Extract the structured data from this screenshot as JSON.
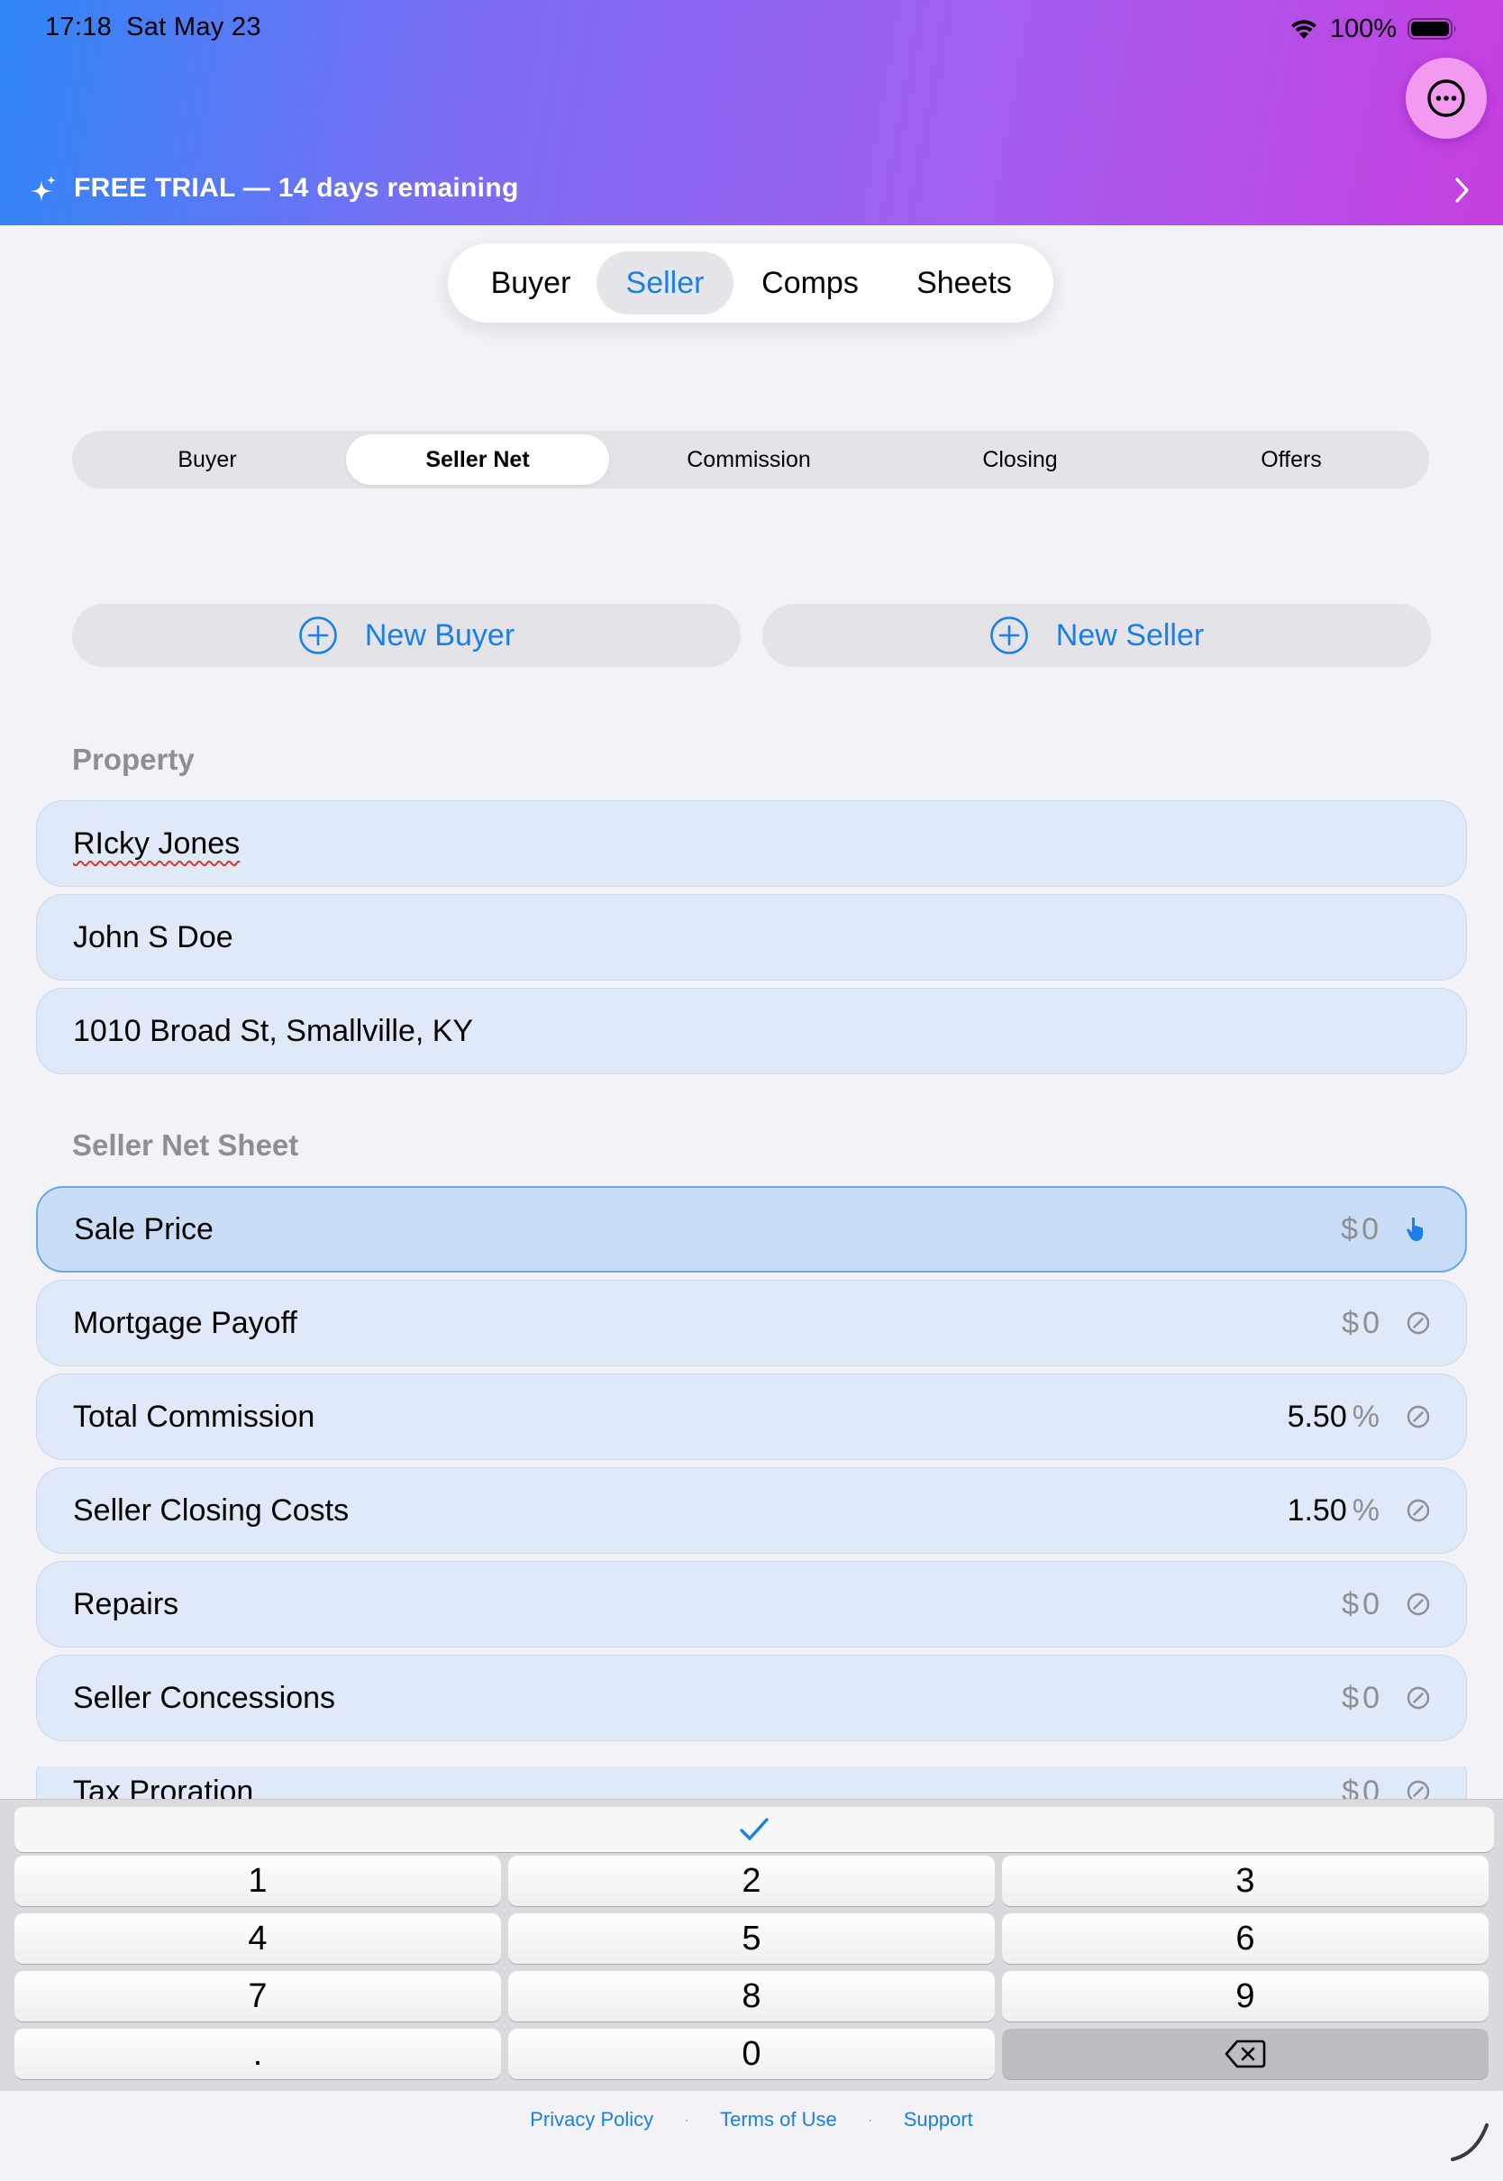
{
  "status_bar": {
    "time": "17:18",
    "date": "Sat May 23",
    "battery": "100%"
  },
  "trial_banner": {
    "text": "FREE TRIAL — 14 days remaining"
  },
  "top_tabs": [
    "Buyer",
    "Seller",
    "Comps",
    "Sheets"
  ],
  "top_tabs_active": "Seller",
  "sub_tabs": [
    "Buyer",
    "Seller Net",
    "Commission",
    "Closing",
    "Offers"
  ],
  "sub_tabs_active": "Seller Net",
  "buttons": {
    "new_buyer": "New Buyer",
    "new_seller": "New Seller"
  },
  "property": {
    "title": "Property",
    "fields": [
      "RIcky Jones",
      "John S Doe",
      "1010 Broad St, Smallville, KY"
    ]
  },
  "net_sheet": {
    "title": "Seller Net Sheet",
    "rows": [
      {
        "label": "Sale Price",
        "unit": "$",
        "value": "0"
      },
      {
        "label": "Mortgage Payoff",
        "unit": "$",
        "value": "0"
      },
      {
        "label": "Total Commission",
        "unit": "%",
        "value": "5.50"
      },
      {
        "label": "Seller Closing Costs",
        "unit": "%",
        "value": "1.50"
      },
      {
        "label": "Repairs",
        "unit": "$",
        "value": "0"
      },
      {
        "label": "Seller Concessions",
        "unit": "$",
        "value": "0"
      },
      {
        "label": "Tax Proration",
        "unit": "$",
        "value": "0"
      }
    ]
  },
  "keypad": {
    "keys": [
      "1",
      "2",
      "3",
      "4",
      "5",
      "6",
      "7",
      "8",
      "9",
      ".",
      "0"
    ]
  },
  "footer": {
    "privacy": "Privacy Policy",
    "terms": "Terms of Use",
    "support": "Support",
    "separator": "·"
  },
  "colors": {
    "accent": "#1a7fe8",
    "field_bg": "#dfe9f7",
    "gradient_start": "#2f86f6",
    "gradient_end": "#c63fe0"
  }
}
